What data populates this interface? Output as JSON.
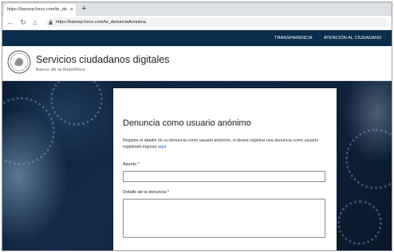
{
  "browser": {
    "tab_title": "https://banrep.force.com/br_de",
    "tab_close": "×",
    "new_tab": "+",
    "url": "https://banrep.force.com/br_denunciaAnonima"
  },
  "topnav": {
    "items": [
      {
        "label": "TRANSPARENCIA"
      },
      {
        "label": "ATENCIÓN AL CIUDADANO"
      }
    ]
  },
  "header": {
    "title": "Servicios ciudadanos digitales",
    "subtitle": "Banco de la República"
  },
  "form": {
    "heading": "Denuncia como usuario anónimo",
    "description": "Registre el detalle de su denuncia como usuario anónimo, si desea registrar una denuncia como usuario registrado ingrese",
    "link_text": "aquí",
    "fields": {
      "subject_label": "Asunto *",
      "subject_value": "",
      "detail_label": "Detalle de la denuncia *",
      "detail_value": ""
    }
  },
  "colors": {
    "nav_bg": "#0b2d4d",
    "link": "#1a6ec8"
  }
}
